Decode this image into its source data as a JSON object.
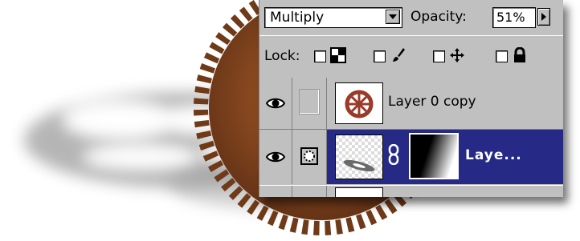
{
  "layers_palette": {
    "blend_mode": "Multiply",
    "opacity_label": "Opacity:",
    "opacity_value": "51%",
    "lock_label": "Lock:",
    "lock_icons": [
      "transparency-lock-icon",
      "brush-lock-icon",
      "move-lock-icon",
      "padlock-icon"
    ],
    "layers": [
      {
        "name": "Layer 0 copy",
        "visible": true,
        "selected": false
      },
      {
        "name": "Laye...",
        "visible": true,
        "selected": true
      }
    ],
    "colors": {
      "panel": "#c0c0c0",
      "selection": "#262a86",
      "gear_rust": "#8a4a23"
    }
  }
}
